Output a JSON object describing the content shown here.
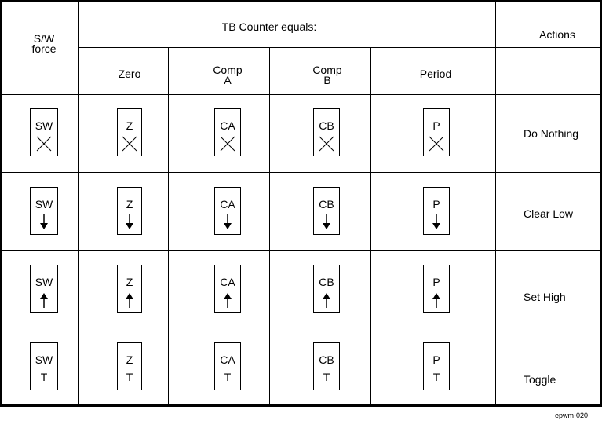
{
  "header": {
    "sw_force": "S/W\nforce",
    "group_title": "TB Counter equals:",
    "actions": "Actions",
    "columns": [
      {
        "key": "zero",
        "label": "Zero",
        "short": "Z"
      },
      {
        "key": "compa",
        "label": "Comp\nA",
        "short": "CA"
      },
      {
        "key": "compb",
        "label": "Comp\nB",
        "short": "CB"
      },
      {
        "key": "period",
        "label": "Period",
        "short": "P"
      }
    ],
    "sw_short": "SW"
  },
  "rows": [
    {
      "action": "Do Nothing",
      "symbol": "cross",
      "symbol_text": ""
    },
    {
      "action": "Clear Low",
      "symbol": "arrow-down",
      "symbol_text": ""
    },
    {
      "action": "Set High",
      "symbol": "arrow-up",
      "symbol_text": ""
    },
    {
      "action": "Toggle",
      "symbol": "toggle",
      "symbol_text": "T"
    }
  ],
  "figure_id": "epwm-020"
}
